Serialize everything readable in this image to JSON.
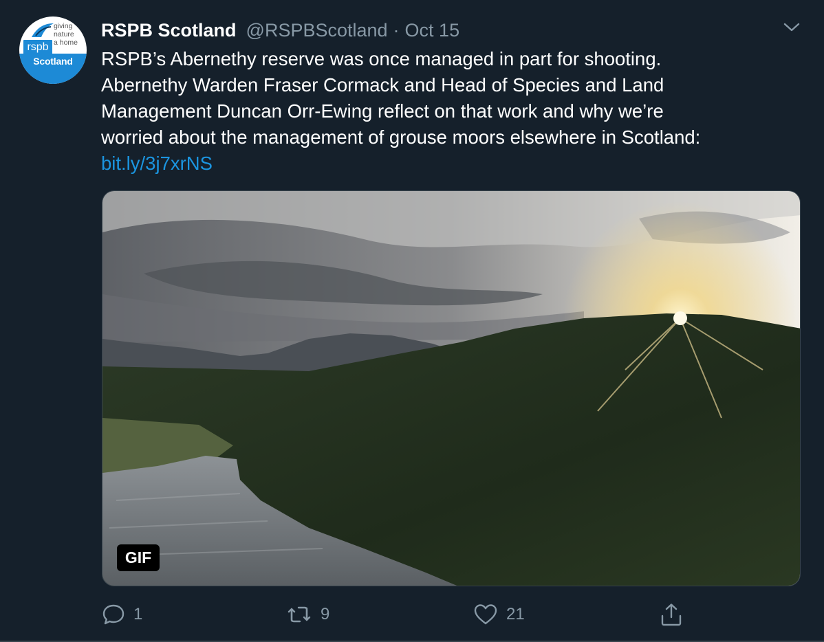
{
  "tweet": {
    "display_name": "RSPB Scotland",
    "handle": "@RSPBScotland",
    "separator": "·",
    "date": "Oct 15",
    "text_lines": [
      "RSPB’s Abernethy reserve was once managed in part for shooting.",
      "Abernethy Warden Fraser Cormack and Head of Species and Land",
      "Management Duncan Orr-Ewing reflect on that work and why we’re",
      "worried about the management of grouse moors elsewhere in Scotland:"
    ],
    "link": "bit.ly/3j7xrNS"
  },
  "avatar": {
    "logo_box": "rspb",
    "tagline_lines": [
      "giving",
      "nature",
      "a home"
    ],
    "region": "Scotland"
  },
  "media": {
    "badge": "GIF"
  },
  "actions": {
    "reply_count": "1",
    "retweet_count": "9",
    "like_count": "21"
  },
  "icons": {
    "menu": "chevron-down-icon",
    "reply": "reply-icon",
    "retweet": "retweet-icon",
    "like": "heart-icon",
    "share": "share-icon"
  },
  "colors": {
    "background": "#15202b",
    "muted": "#8899a6",
    "link": "#1b95e0",
    "brand": "#1d8ad6"
  }
}
